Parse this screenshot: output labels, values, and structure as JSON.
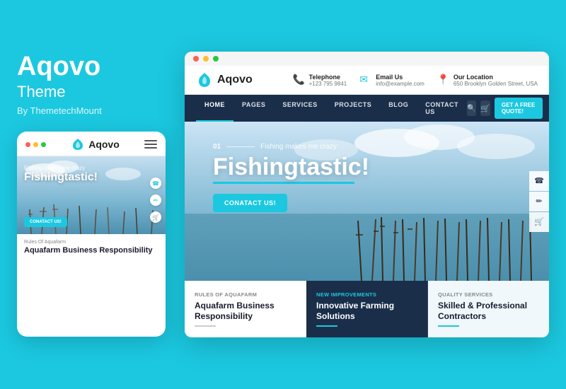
{
  "brand": {
    "name": "Aqovo",
    "subtitle": "Theme",
    "by": "By ThemetechMount"
  },
  "mobile": {
    "logo": "Aqovo",
    "tagline": "Fishing makes me crazy",
    "hero_title": "Fishingtastic!",
    "cta": "CONATACT US!",
    "service_label": "Rules Of Aquafarm",
    "service_title": "Aquafarm Business Responsibility"
  },
  "desktop": {
    "top_dots": [
      "#ff5f57",
      "#ffbd2e",
      "#28c840"
    ],
    "logo": "Aqovo",
    "contact": [
      {
        "icon": "📞",
        "label": "Telephone",
        "value": "+123 795 9841"
      },
      {
        "icon": "✉",
        "label": "Email Us",
        "value": "info@example.com"
      },
      {
        "icon": "📍",
        "label": "Our Location",
        "value": "650 Brooklyn Golden Street, USA"
      }
    ],
    "nav": {
      "links": [
        "HOME",
        "PAGES",
        "SERVICES",
        "PROJECTS",
        "BLOG",
        "CONTACT US"
      ],
      "active": "HOME",
      "quote_btn": "GET A FREE QUOTE!"
    },
    "hero": {
      "num": "01",
      "tagline": "Fishing makes me crazy",
      "title": "Fishingtastic!",
      "cta": "CONATACT US!"
    },
    "services": [
      {
        "label": "Rules Of Aquafarm",
        "title": "Aquafarm Business Responsibility",
        "highlighted": false
      },
      {
        "label": "New Improvements",
        "title": "Innovative Farming Solutions",
        "highlighted": true
      },
      {
        "label": "Quality Services",
        "title": "Skilled & Professional Contractors",
        "highlighted": false
      }
    ]
  }
}
